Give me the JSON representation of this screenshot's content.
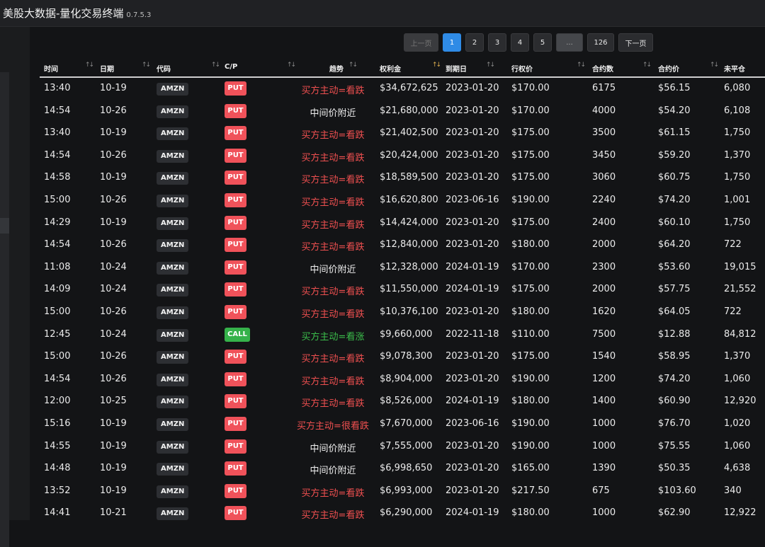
{
  "app": {
    "title": "美股大数据-量化交易终端",
    "version": "0.7.5.3"
  },
  "pagination": {
    "prev": "上一页",
    "pages": [
      "1",
      "2",
      "3",
      "4",
      "5",
      "...",
      "126"
    ],
    "active_page": "1",
    "next": "下一页"
  },
  "columns": [
    "时间",
    "日期",
    "代码",
    "C/P",
    "趋势",
    "权利金",
    "到期日",
    "行权价",
    "合约数",
    "合约价",
    "未平仓"
  ],
  "colors": {
    "put": "#f0525a",
    "call": "#35b24a",
    "bearish_text": "#f05050",
    "bullish_text": "#3bbd4b",
    "neutral_text": "#f0f0f0",
    "accent": "#2f8be6"
  },
  "rows": [
    {
      "time": "13:40",
      "date": "10-19",
      "ticker": "AMZN",
      "cp": "PUT",
      "trend": "买方主动=看跌",
      "premium": "$34,672,625",
      "expiry": "2023-01-20",
      "strike": "$170.00",
      "contracts": "6175",
      "price": "$56.15",
      "oi": "6,080"
    },
    {
      "time": "14:54",
      "date": "10-26",
      "ticker": "AMZN",
      "cp": "PUT",
      "trend": "中间价附近",
      "premium": "$21,680,000",
      "expiry": "2023-01-20",
      "strike": "$170.00",
      "contracts": "4000",
      "price": "$54.20",
      "oi": "6,108"
    },
    {
      "time": "13:40",
      "date": "10-19",
      "ticker": "AMZN",
      "cp": "PUT",
      "trend": "买方主动=看跌",
      "premium": "$21,402,500",
      "expiry": "2023-01-20",
      "strike": "$175.00",
      "contracts": "3500",
      "price": "$61.15",
      "oi": "1,750"
    },
    {
      "time": "14:54",
      "date": "10-26",
      "ticker": "AMZN",
      "cp": "PUT",
      "trend": "买方主动=看跌",
      "premium": "$20,424,000",
      "expiry": "2023-01-20",
      "strike": "$175.00",
      "contracts": "3450",
      "price": "$59.20",
      "oi": "1,370"
    },
    {
      "time": "14:58",
      "date": "10-19",
      "ticker": "AMZN",
      "cp": "PUT",
      "trend": "买方主动=看跌",
      "premium": "$18,589,500",
      "expiry": "2023-01-20",
      "strike": "$175.00",
      "contracts": "3060",
      "price": "$60.75",
      "oi": "1,750"
    },
    {
      "time": "15:00",
      "date": "10-26",
      "ticker": "AMZN",
      "cp": "PUT",
      "trend": "买方主动=看跌",
      "premium": "$16,620,800",
      "expiry": "2023-06-16",
      "strike": "$190.00",
      "contracts": "2240",
      "price": "$74.20",
      "oi": "1,001"
    },
    {
      "time": "14:29",
      "date": "10-19",
      "ticker": "AMZN",
      "cp": "PUT",
      "trend": "买方主动=看跌",
      "premium": "$14,424,000",
      "expiry": "2023-01-20",
      "strike": "$175.00",
      "contracts": "2400",
      "price": "$60.10",
      "oi": "1,750"
    },
    {
      "time": "14:54",
      "date": "10-26",
      "ticker": "AMZN",
      "cp": "PUT",
      "trend": "买方主动=看跌",
      "premium": "$12,840,000",
      "expiry": "2023-01-20",
      "strike": "$180.00",
      "contracts": "2000",
      "price": "$64.20",
      "oi": "722"
    },
    {
      "time": "11:08",
      "date": "10-24",
      "ticker": "AMZN",
      "cp": "PUT",
      "trend": "中间价附近",
      "premium": "$12,328,000",
      "expiry": "2024-01-19",
      "strike": "$170.00",
      "contracts": "2300",
      "price": "$53.60",
      "oi": "19,015"
    },
    {
      "time": "14:09",
      "date": "10-24",
      "ticker": "AMZN",
      "cp": "PUT",
      "trend": "买方主动=看跌",
      "premium": "$11,550,000",
      "expiry": "2024-01-19",
      "strike": "$175.00",
      "contracts": "2000",
      "price": "$57.75",
      "oi": "21,552"
    },
    {
      "time": "15:00",
      "date": "10-26",
      "ticker": "AMZN",
      "cp": "PUT",
      "trend": "买方主动=看跌",
      "premium": "$10,376,100",
      "expiry": "2023-01-20",
      "strike": "$180.00",
      "contracts": "1620",
      "price": "$64.05",
      "oi": "722"
    },
    {
      "time": "12:45",
      "date": "10-24",
      "ticker": "AMZN",
      "cp": "CALL",
      "trend": "买方主动=看涨",
      "premium": "$9,660,000",
      "expiry": "2022-11-18",
      "strike": "$110.00",
      "contracts": "7500",
      "price": "$12.88",
      "oi": "84,812"
    },
    {
      "time": "15:00",
      "date": "10-26",
      "ticker": "AMZN",
      "cp": "PUT",
      "trend": "买方主动=看跌",
      "premium": "$9,078,300",
      "expiry": "2023-01-20",
      "strike": "$175.00",
      "contracts": "1540",
      "price": "$58.95",
      "oi": "1,370"
    },
    {
      "time": "14:54",
      "date": "10-26",
      "ticker": "AMZN",
      "cp": "PUT",
      "trend": "买方主动=看跌",
      "premium": "$8,904,000",
      "expiry": "2023-01-20",
      "strike": "$190.00",
      "contracts": "1200",
      "price": "$74.20",
      "oi": "1,060"
    },
    {
      "time": "12:00",
      "date": "10-25",
      "ticker": "AMZN",
      "cp": "PUT",
      "trend": "买方主动=看跌",
      "premium": "$8,526,000",
      "expiry": "2024-01-19",
      "strike": "$180.00",
      "contracts": "1400",
      "price": "$60.90",
      "oi": "12,920"
    },
    {
      "time": "15:16",
      "date": "10-19",
      "ticker": "AMZN",
      "cp": "PUT",
      "trend": "买方主动=很看跌",
      "premium": "$7,670,000",
      "expiry": "2023-06-16",
      "strike": "$190.00",
      "contracts": "1000",
      "price": "$76.70",
      "oi": "1,020"
    },
    {
      "time": "14:55",
      "date": "10-19",
      "ticker": "AMZN",
      "cp": "PUT",
      "trend": "中间价附近",
      "premium": "$7,555,000",
      "expiry": "2023-01-20",
      "strike": "$190.00",
      "contracts": "1000",
      "price": "$75.55",
      "oi": "1,060"
    },
    {
      "time": "14:48",
      "date": "10-19",
      "ticker": "AMZN",
      "cp": "PUT",
      "trend": "中间价附近",
      "premium": "$6,998,650",
      "expiry": "2023-01-20",
      "strike": "$165.00",
      "contracts": "1390",
      "price": "$50.35",
      "oi": "4,638"
    },
    {
      "time": "13:52",
      "date": "10-19",
      "ticker": "AMZN",
      "cp": "PUT",
      "trend": "买方主动=看跌",
      "premium": "$6,993,000",
      "expiry": "2023-01-20",
      "strike": "$217.50",
      "contracts": "675",
      "price": "$103.60",
      "oi": "340"
    },
    {
      "time": "14:41",
      "date": "10-21",
      "ticker": "AMZN",
      "cp": "PUT",
      "trend": "买方主动=看跌",
      "premium": "$6,290,000",
      "expiry": "2024-01-19",
      "strike": "$180.00",
      "contracts": "1000",
      "price": "$62.90",
      "oi": "12,922"
    }
  ]
}
